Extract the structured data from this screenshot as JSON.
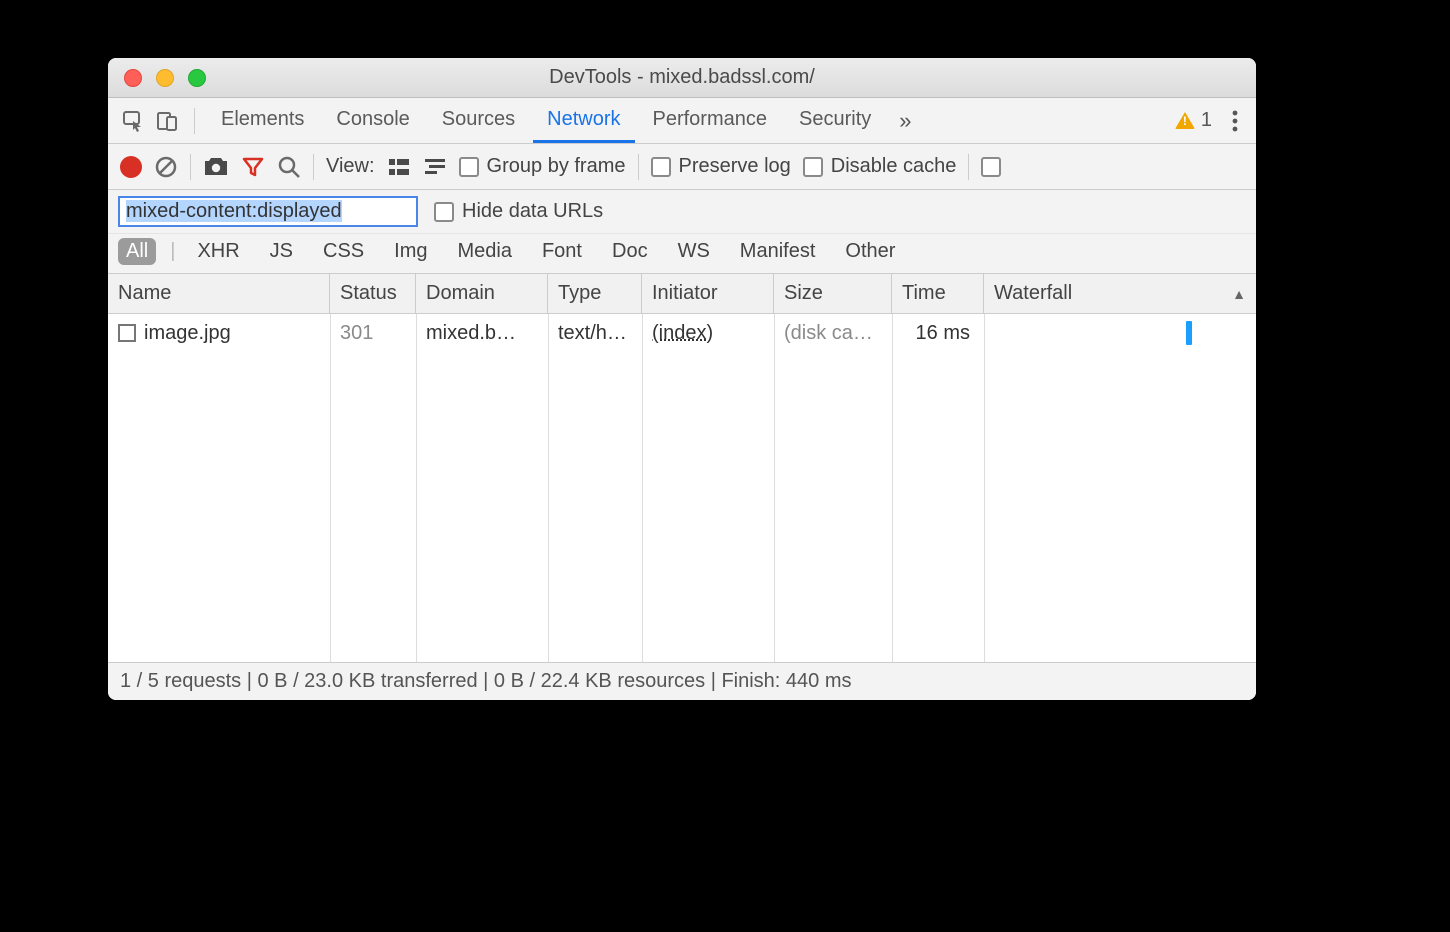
{
  "window": {
    "title": "DevTools - mixed.badssl.com/"
  },
  "tabs": {
    "items": [
      "Elements",
      "Console",
      "Sources",
      "Network",
      "Performance",
      "Security"
    ],
    "active": "Network",
    "warnings_count": "1"
  },
  "toolbar": {
    "view_label": "View:",
    "group_by_frame": "Group by frame",
    "preserve_log": "Preserve log",
    "disable_cache": "Disable cache"
  },
  "filter": {
    "value": "mixed-content:displayed",
    "hide_data_urls": "Hide data URLs"
  },
  "type_filters": [
    "All",
    "XHR",
    "JS",
    "CSS",
    "Img",
    "Media",
    "Font",
    "Doc",
    "WS",
    "Manifest",
    "Other"
  ],
  "type_filters_active": "All",
  "columns": [
    "Name",
    "Status",
    "Domain",
    "Type",
    "Initiator",
    "Size",
    "Time",
    "Waterfall"
  ],
  "sort_column": "Waterfall",
  "rows": [
    {
      "name": "image.jpg",
      "status": "301",
      "domain": "mixed.b…",
      "type": "text/h…",
      "initiator": "(index)",
      "size": "(disk ca…",
      "time": "16 ms"
    }
  ],
  "status": "1 / 5 requests | 0 B / 23.0 KB transferred | 0 B / 22.4 KB resources | Finish: 440 ms"
}
